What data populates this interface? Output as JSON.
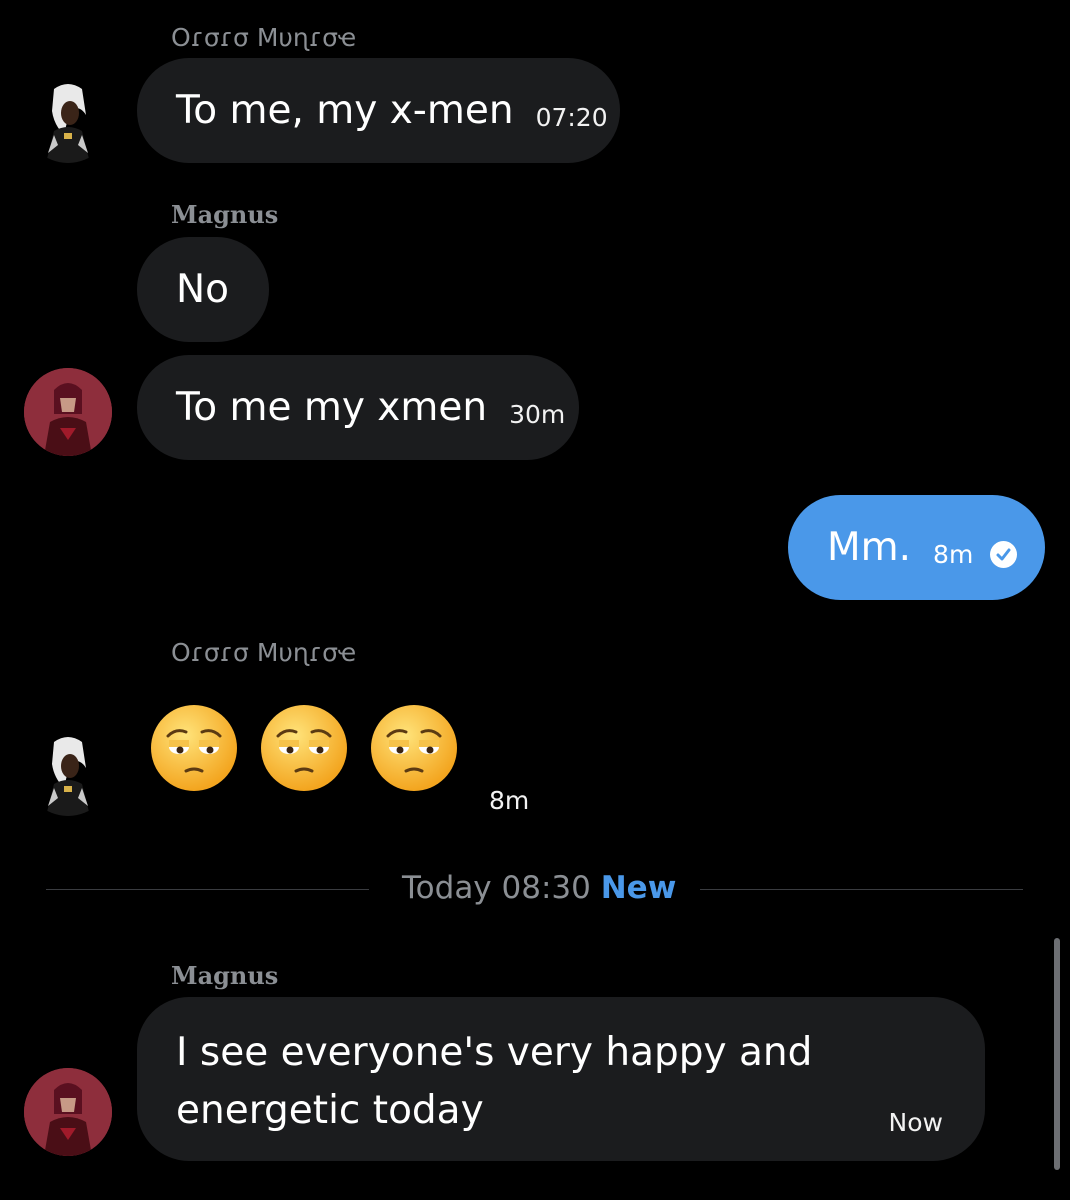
{
  "messages": [
    {
      "sender": "Oɾσɾσ Mυɳɾσҽ",
      "text": "To me, my x-men",
      "time": "07:20"
    },
    {
      "sender": "Magnus",
      "text": "No"
    },
    {
      "text": "To me my xmen",
      "time": "30m"
    },
    {
      "outgoing": true,
      "text": "Mm.",
      "time": "8m",
      "status_icon": "read-check-icon"
    },
    {
      "sender": "Oɾσɾσ Mυɳɾσҽ",
      "emojis": [
        "😔",
        "😔",
        "😔"
      ],
      "emoji_name": "pensive-face",
      "time": "8m"
    }
  ],
  "divider": {
    "label": "Today 08:30",
    "badge": "New"
  },
  "last_message": {
    "sender": "Magnus",
    "text": "I see everyone's very happy and energetic today",
    "time": "Now"
  },
  "colors": {
    "background": "#000000",
    "incoming_bubble": "#1b1c1e",
    "outgoing_bubble": "#4a98e9",
    "accent": "#4a98e9",
    "muted_text": "#8b8f94"
  }
}
